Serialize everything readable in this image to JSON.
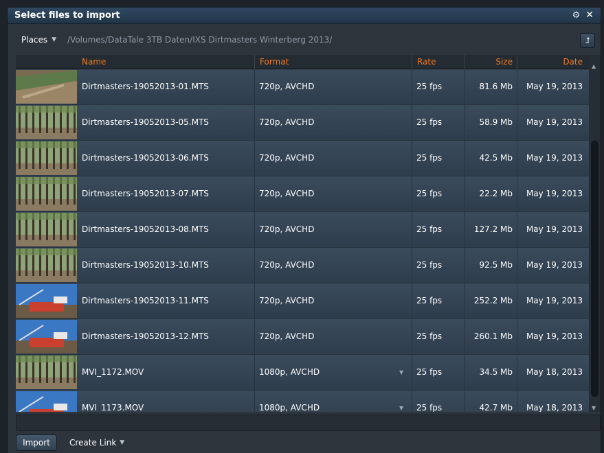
{
  "window": {
    "title": "Select files to import"
  },
  "pathbar": {
    "places_label": "Places",
    "path": "/Volumes/DataTale 3TB Daten/IXS Dirtmasters Winterberg 2013/"
  },
  "columns": {
    "name": "Name",
    "format": "Format",
    "rate": "Rate",
    "size": "Size",
    "date": "Date"
  },
  "files": [
    {
      "name": "Dirtmasters-19052013-01.MTS",
      "format": "720p, AVCHD",
      "rate": "25 fps",
      "size": "81.6 Mb",
      "date": "May 19, 2013",
      "thumb": "dirt"
    },
    {
      "name": "Dirtmasters-19052013-05.MTS",
      "format": "720p, AVCHD",
      "rate": "25 fps",
      "size": "58.9 Mb",
      "date": "May 19, 2013",
      "thumb": "forest"
    },
    {
      "name": "Dirtmasters-19052013-06.MTS",
      "format": "720p, AVCHD",
      "rate": "25 fps",
      "size": "42.5 Mb",
      "date": "May 19, 2013",
      "thumb": "forest"
    },
    {
      "name": "Dirtmasters-19052013-07.MTS",
      "format": "720p, AVCHD",
      "rate": "25 fps",
      "size": "22.2 Mb",
      "date": "May 19, 2013",
      "thumb": "forest"
    },
    {
      "name": "Dirtmasters-19052013-08.MTS",
      "format": "720p, AVCHD",
      "rate": "25 fps",
      "size": "127.2 Mb",
      "date": "May 19, 2013",
      "thumb": "forest"
    },
    {
      "name": "Dirtmasters-19052013-10.MTS",
      "format": "720p, AVCHD",
      "rate": "25 fps",
      "size": "92.5 Mb",
      "date": "May 19, 2013",
      "thumb": "forest"
    },
    {
      "name": "Dirtmasters-19052013-11.MTS",
      "format": "720p, AVCHD",
      "rate": "25 fps",
      "size": "252.2 Mb",
      "date": "May 19, 2013",
      "thumb": "sky"
    },
    {
      "name": "Dirtmasters-19052013-12.MTS",
      "format": "720p, AVCHD",
      "rate": "25 fps",
      "size": "260.1 Mb",
      "date": "May 19, 2013",
      "thumb": "sky"
    },
    {
      "name": "MVI_1172.MOV",
      "format": "1080p, AVCHD",
      "rate": "25 fps",
      "size": "34.5 Mb",
      "date": "May 18, 2013",
      "thumb": "forest",
      "format_menu": true
    },
    {
      "name": "MVI_1173.MOV",
      "format": "1080p, AVCHD",
      "rate": "25 fps",
      "size": "42.7 Mb",
      "date": "May 18, 2013",
      "thumb": "sky",
      "format_menu": true
    }
  ],
  "bottom": {
    "import_label": "Import",
    "create_link_label": "Create Link"
  },
  "colors": {
    "accent": "#f07a1e",
    "row": "#34465a",
    "titlebar": "#2a3f55"
  }
}
